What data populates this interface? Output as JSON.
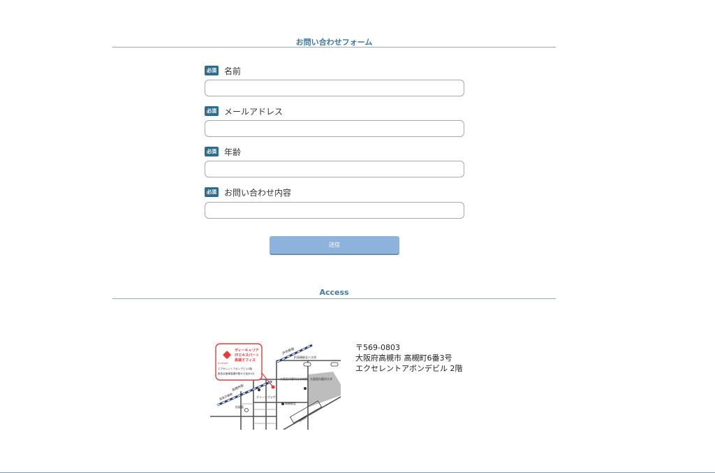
{
  "contact": {
    "heading": "お問い合わせフォーム",
    "required_badge": "必須",
    "fields": [
      {
        "label": "名前",
        "value": "",
        "placeholder": ""
      },
      {
        "label": "メールアドレス",
        "value": "",
        "placeholder": ""
      },
      {
        "label": "年齢",
        "value": "",
        "placeholder": ""
      },
      {
        "label": "お問い合わせ内容",
        "value": "",
        "placeholder": ""
      }
    ],
    "submit_label": "送信"
  },
  "access": {
    "heading": "Access",
    "address_lines": [
      "〒569-0803",
      "大阪府高槻市 高槻町6番3号",
      "エクセレントアボンデビル 2階"
    ],
    "map": {
      "callout_lines": [
        "ディーキャリア",
        "ITエキスパート",
        "高槻オフィス"
      ],
      "callout_sub_lines": [
        "エクセレントアボンデビル2階",
        "阪急京都線高槻市駅から徒歩4分"
      ],
      "callout_logo": "d-career",
      "labels": {
        "jr_line": "JR京都線",
        "bus_stop": "JR高槻駅北バス停",
        "medical_univ": "大阪医科薬科大学病院",
        "school": "大阪医科薬科大学",
        "green_plaza": "グリーンプラザ",
        "church": "高槻教会",
        "station": "高槻市駅",
        "matsuzakaya": "松坂屋",
        "hankyu_line": "阪急京都線",
        "jr_station": "高槻駅"
      }
    }
  },
  "colors": {
    "accent": "#3d7ba0",
    "badge": "#2f6d8e",
    "button": "#8db3dd",
    "map_callout": "#e83a3a"
  }
}
